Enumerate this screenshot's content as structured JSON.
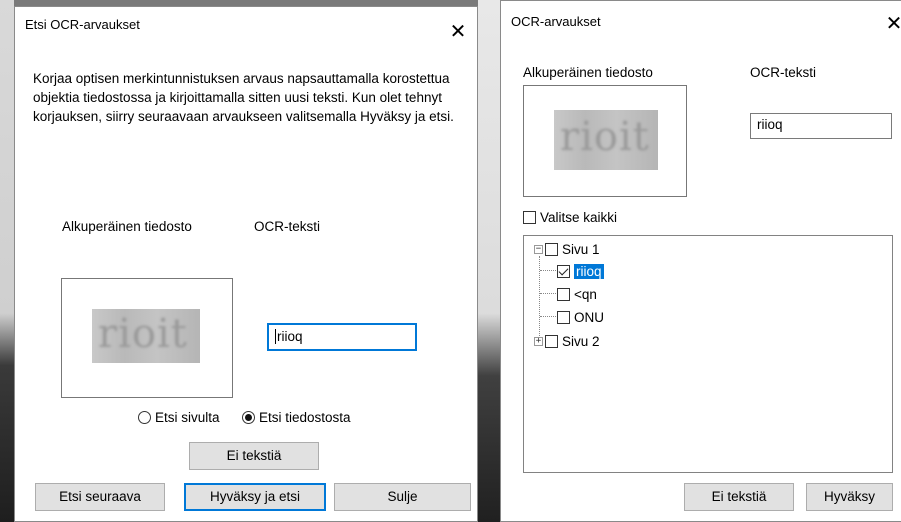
{
  "find_dialog": {
    "title": "Etsi OCR-arvaukset",
    "description": "Korjaa optisen merkintunnistuksen arvaus napsauttamalla korostettua objektia tiedostossa ja kirjoittamalla sitten uusi teksti. Kun olet tehnyt korjauksen, siirry seuraavaan arvaukseen valitsemalla Hyväksy ja etsi.",
    "original_file_label": "Alkuperäinen tiedosto",
    "ocr_text_label": "OCR-teksti",
    "ocr_image_text": "rioit",
    "ocr_value": "riioq",
    "radio_page": "Etsi sivulta",
    "radio_document": "Etsi tiedostosta",
    "radio_selected": "Etsi tiedostosta",
    "no_text_button": "Ei tekstiä",
    "find_next_button": "Etsi seuraava",
    "accept_find_button": "Hyväksy ja etsi",
    "close_button": "Sulje"
  },
  "suspects_dialog": {
    "title": "OCR-arvaukset",
    "original_file_label": "Alkuperäinen tiedosto",
    "ocr_text_label": "OCR-teksti",
    "ocr_image_text": "rioit",
    "ocr_value": "riioq",
    "select_all_label": "Valitse kaikki",
    "tree": {
      "page1": "Sivu 1",
      "items": [
        {
          "label": "riioq",
          "checked": true,
          "selected": true
        },
        {
          "label": "<qn",
          "checked": false,
          "selected": false
        },
        {
          "label": "ONU",
          "checked": false,
          "selected": false
        }
      ],
      "page2": "Sivu 2"
    },
    "no_text_button": "Ei tekstiä",
    "accept_button": "Hyväksy"
  },
  "colors": {
    "accent": "#0078d7",
    "button_bg": "#e1e1e1"
  }
}
